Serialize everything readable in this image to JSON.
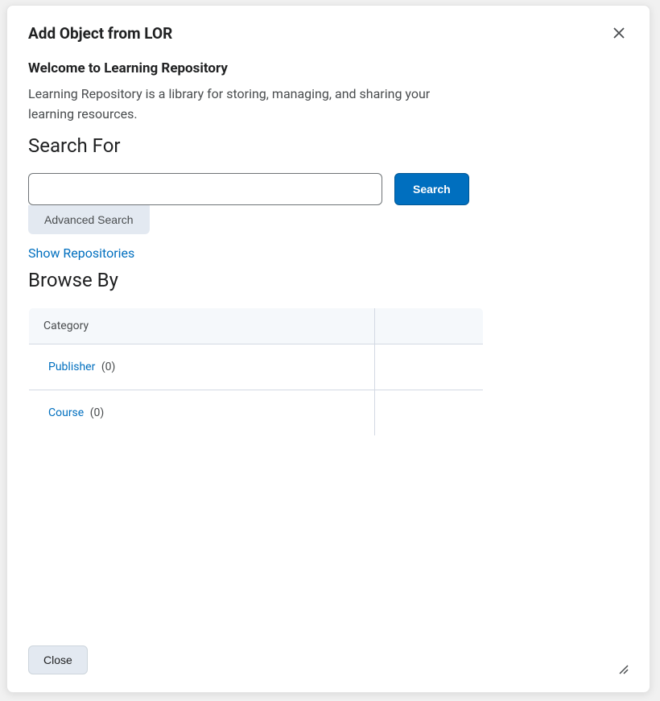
{
  "header": {
    "title": "Add Object from LOR"
  },
  "welcome": {
    "title": "Welcome to Learning Repository",
    "description": "Learning Repository is a library for storing, managing, and sharing your learning resources."
  },
  "search": {
    "heading": "Search For",
    "value": "",
    "placeholder": "",
    "button_label": "Search",
    "advanced_label": "Advanced Search",
    "show_repos_label": "Show Repositories"
  },
  "browse": {
    "heading": "Browse By",
    "header_col1": "Category",
    "header_col2": "",
    "rows": [
      {
        "label": "Publisher",
        "count": "(0)"
      },
      {
        "label": "Course",
        "count": "(0)"
      }
    ]
  },
  "footer": {
    "close_label": "Close"
  }
}
